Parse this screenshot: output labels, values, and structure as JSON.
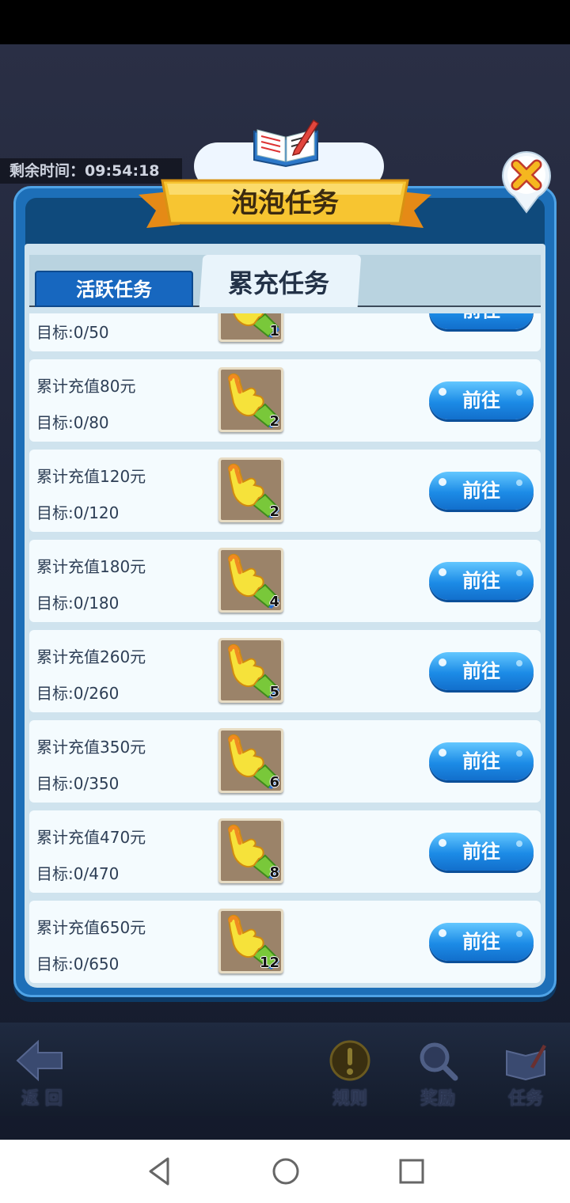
{
  "timer": {
    "text": "剩余时间：09:54:18"
  },
  "dialog": {
    "title": "泡泡任务",
    "tabs": [
      {
        "label": "活跃任务",
        "selected": false
      },
      {
        "label": "累充任务",
        "selected": true
      }
    ]
  },
  "tasks": [
    {
      "title": "",
      "goal": "目标:0/50",
      "count": "1",
      "button": "前往"
    },
    {
      "title": "累计充值80元",
      "goal": "目标:0/80",
      "count": "2",
      "button": "前往"
    },
    {
      "title": "累计充值120元",
      "goal": "目标:0/120",
      "count": "2",
      "button": "前往"
    },
    {
      "title": "累计充值180元",
      "goal": "目标:0/180",
      "count": "4",
      "button": "前往"
    },
    {
      "title": "累计充值260元",
      "goal": "目标:0/260",
      "count": "5",
      "button": "前往"
    },
    {
      "title": "累计充值350元",
      "goal": "目标:0/350",
      "count": "6",
      "button": "前往"
    },
    {
      "title": "累计充值470元",
      "goal": "目标:0/470",
      "count": "8",
      "button": "前往"
    },
    {
      "title": "累计充值650元",
      "goal": "目标:0/650",
      "count": "12",
      "button": "前往"
    }
  ],
  "bottom_nav": {
    "back": "返 回",
    "rules": "规则",
    "rewards": "奖励",
    "tasks": "任务"
  },
  "colors": {
    "panel_blue": "#1d6fb8",
    "button_blue": "#1c8be6",
    "ribbon_yellow": "#f7c531"
  }
}
